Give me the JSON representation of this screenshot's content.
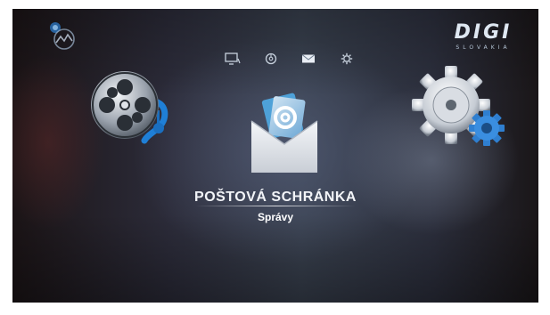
{
  "screen": {
    "logo": {
      "brand": "DIGI",
      "sub": "SLOVAKIA"
    },
    "menu": {
      "items": [
        {
          "icon": "tv-monitor-icon"
        },
        {
          "icon": "globe-icon"
        },
        {
          "icon": "mail-envelope-icon",
          "active": true
        },
        {
          "icon": "settings-gear-icon"
        }
      ]
    },
    "selection": {
      "title": "POŠTOVÁ SCHRÁNKA",
      "subtitle": "Správy"
    },
    "icons": {
      "left": "film-reel-music-icon",
      "center": "mail-envelope-at-icon",
      "right": "settings-gears-icon",
      "top_left": "signal-status-icon"
    },
    "colors": {
      "accent": "#1e88d8",
      "text": "#f2f4f8"
    }
  }
}
